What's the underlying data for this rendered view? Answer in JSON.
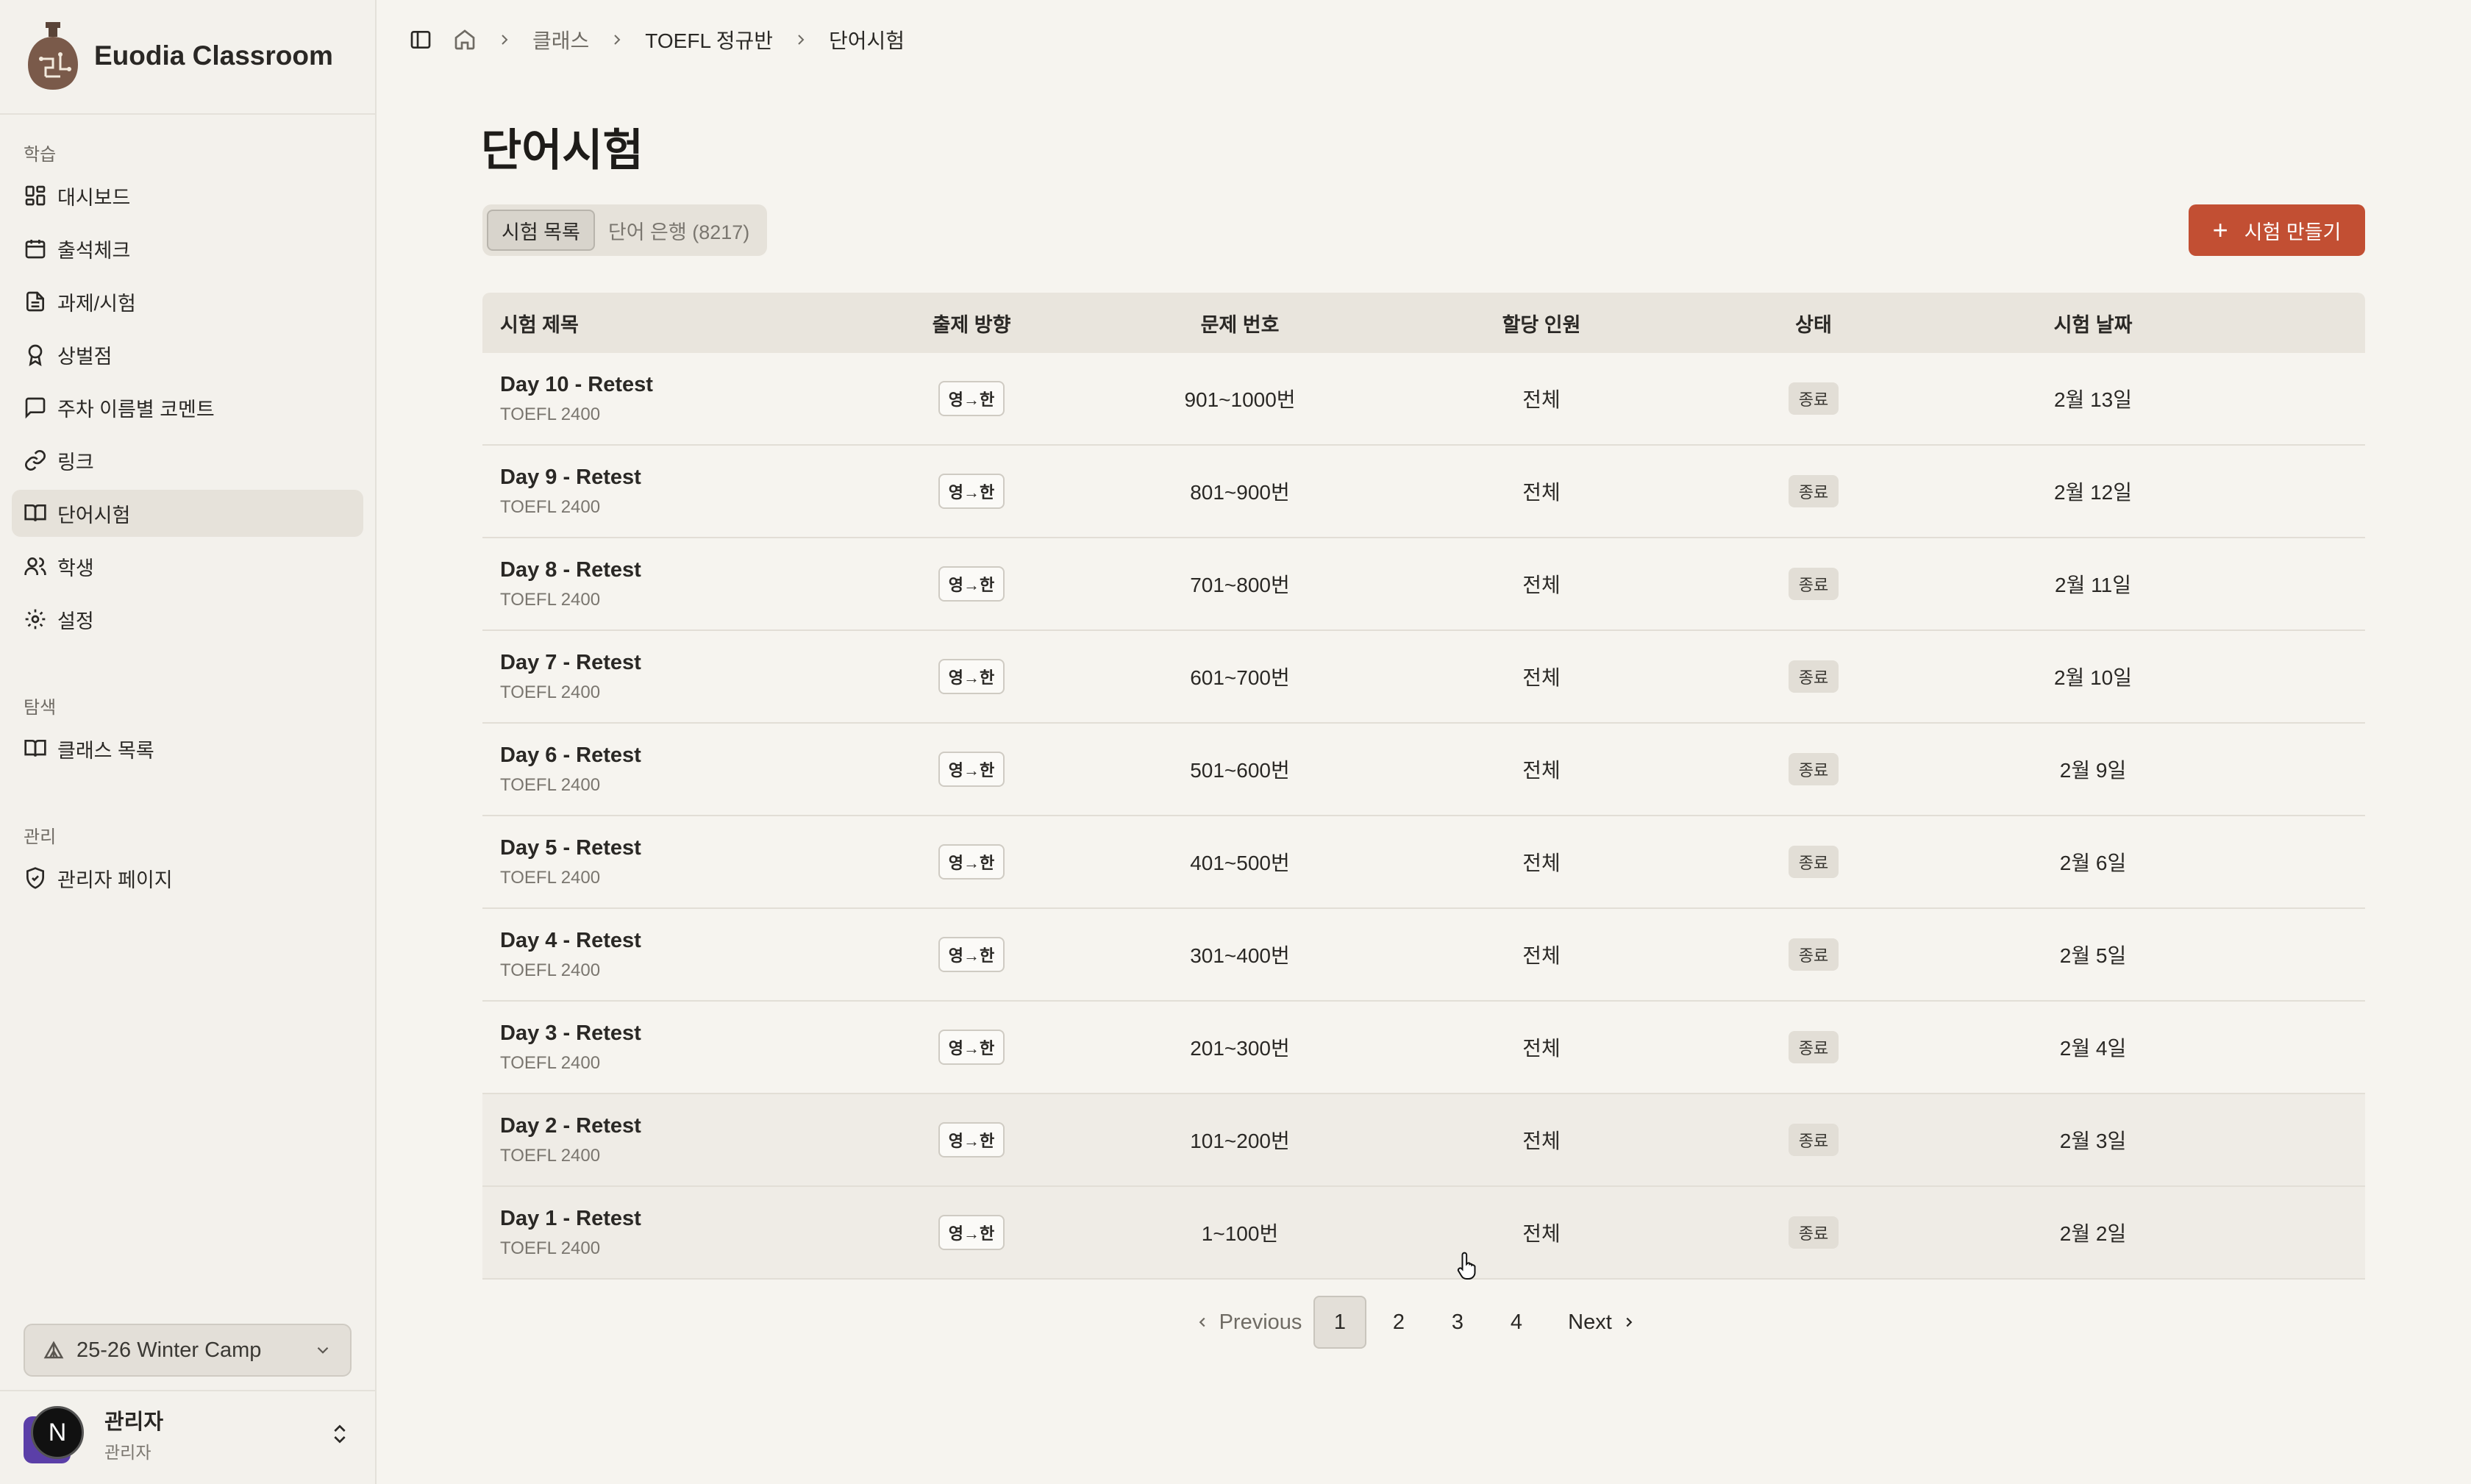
{
  "app": {
    "name": "Euodia Classroom"
  },
  "sidebar": {
    "sections": [
      {
        "label": "학습",
        "items": [
          {
            "label": "대시보드",
            "icon": "dashboard-icon"
          },
          {
            "label": "출석체크",
            "icon": "calendar-icon"
          },
          {
            "label": "과제/시험",
            "icon": "document-icon"
          },
          {
            "label": "상벌점",
            "icon": "award-icon"
          },
          {
            "label": "주차 이름별 코멘트",
            "icon": "comment-icon"
          },
          {
            "label": "링크",
            "icon": "link-icon"
          },
          {
            "label": "단어시험",
            "icon": "book-icon",
            "active": true
          },
          {
            "label": "학생",
            "icon": "users-icon"
          },
          {
            "label": "설정",
            "icon": "gear-icon"
          }
        ]
      },
      {
        "label": "탐색",
        "items": [
          {
            "label": "클래스 목록",
            "icon": "book-icon"
          }
        ]
      },
      {
        "label": "관리",
        "items": [
          {
            "label": "관리자 페이지",
            "icon": "shield-icon"
          }
        ]
      }
    ],
    "season": "25-26 Winter Camp",
    "user": {
      "name": "관리자",
      "role": "관리자",
      "badge": "N"
    }
  },
  "breadcrumb": [
    "클래스",
    "TOEFL 정규반",
    "단어시험"
  ],
  "page": {
    "title": "단어시험"
  },
  "tabs": [
    {
      "label": "시험 목록",
      "active": true
    },
    {
      "label": "단어 은행 (8217)",
      "active": false
    }
  ],
  "create_button": {
    "label": "시험 만들기"
  },
  "table": {
    "headers": [
      "시험 제목",
      "출제 방향",
      "문제 번호",
      "할당 인원",
      "상태",
      "시험 날짜"
    ],
    "rows": [
      {
        "title": "Day 10 - Retest",
        "book": "TOEFL 2400",
        "direction": "영→한",
        "range": "901~1000번",
        "assigned": "전체",
        "status": "종료",
        "date": "2월 13일"
      },
      {
        "title": "Day 9 - Retest",
        "book": "TOEFL 2400",
        "direction": "영→한",
        "range": "801~900번",
        "assigned": "전체",
        "status": "종료",
        "date": "2월 12일"
      },
      {
        "title": "Day 8 - Retest",
        "book": "TOEFL 2400",
        "direction": "영→한",
        "range": "701~800번",
        "assigned": "전체",
        "status": "종료",
        "date": "2월 11일"
      },
      {
        "title": "Day 7 - Retest",
        "book": "TOEFL 2400",
        "direction": "영→한",
        "range": "601~700번",
        "assigned": "전체",
        "status": "종료",
        "date": "2월 10일"
      },
      {
        "title": "Day 6 - Retest",
        "book": "TOEFL 2400",
        "direction": "영→한",
        "range": "501~600번",
        "assigned": "전체",
        "status": "종료",
        "date": "2월 9일"
      },
      {
        "title": "Day 5 - Retest",
        "book": "TOEFL 2400",
        "direction": "영→한",
        "range": "401~500번",
        "assigned": "전체",
        "status": "종료",
        "date": "2월 6일"
      },
      {
        "title": "Day 4 - Retest",
        "book": "TOEFL 2400",
        "direction": "영→한",
        "range": "301~400번",
        "assigned": "전체",
        "status": "종료",
        "date": "2월 5일"
      },
      {
        "title": "Day 3 - Retest",
        "book": "TOEFL 2400",
        "direction": "영→한",
        "range": "201~300번",
        "assigned": "전체",
        "status": "종료",
        "date": "2월 4일"
      },
      {
        "title": "Day 2 - Retest",
        "book": "TOEFL 2400",
        "direction": "영→한",
        "range": "101~200번",
        "assigned": "전체",
        "status": "종료",
        "date": "2월 3일"
      },
      {
        "title": "Day 1 - Retest",
        "book": "TOEFL 2400",
        "direction": "영→한",
        "range": "1~100번",
        "assigned": "전체",
        "status": "종료",
        "date": "2월 2일"
      }
    ]
  },
  "pagination": {
    "previous": "Previous",
    "next": "Next",
    "pages": [
      "1",
      "2",
      "3",
      "4"
    ],
    "current": "1"
  },
  "colors": {
    "accent": "#c24f33",
    "background": "#f6f4ef",
    "sidebar": "#f3f1ec"
  }
}
